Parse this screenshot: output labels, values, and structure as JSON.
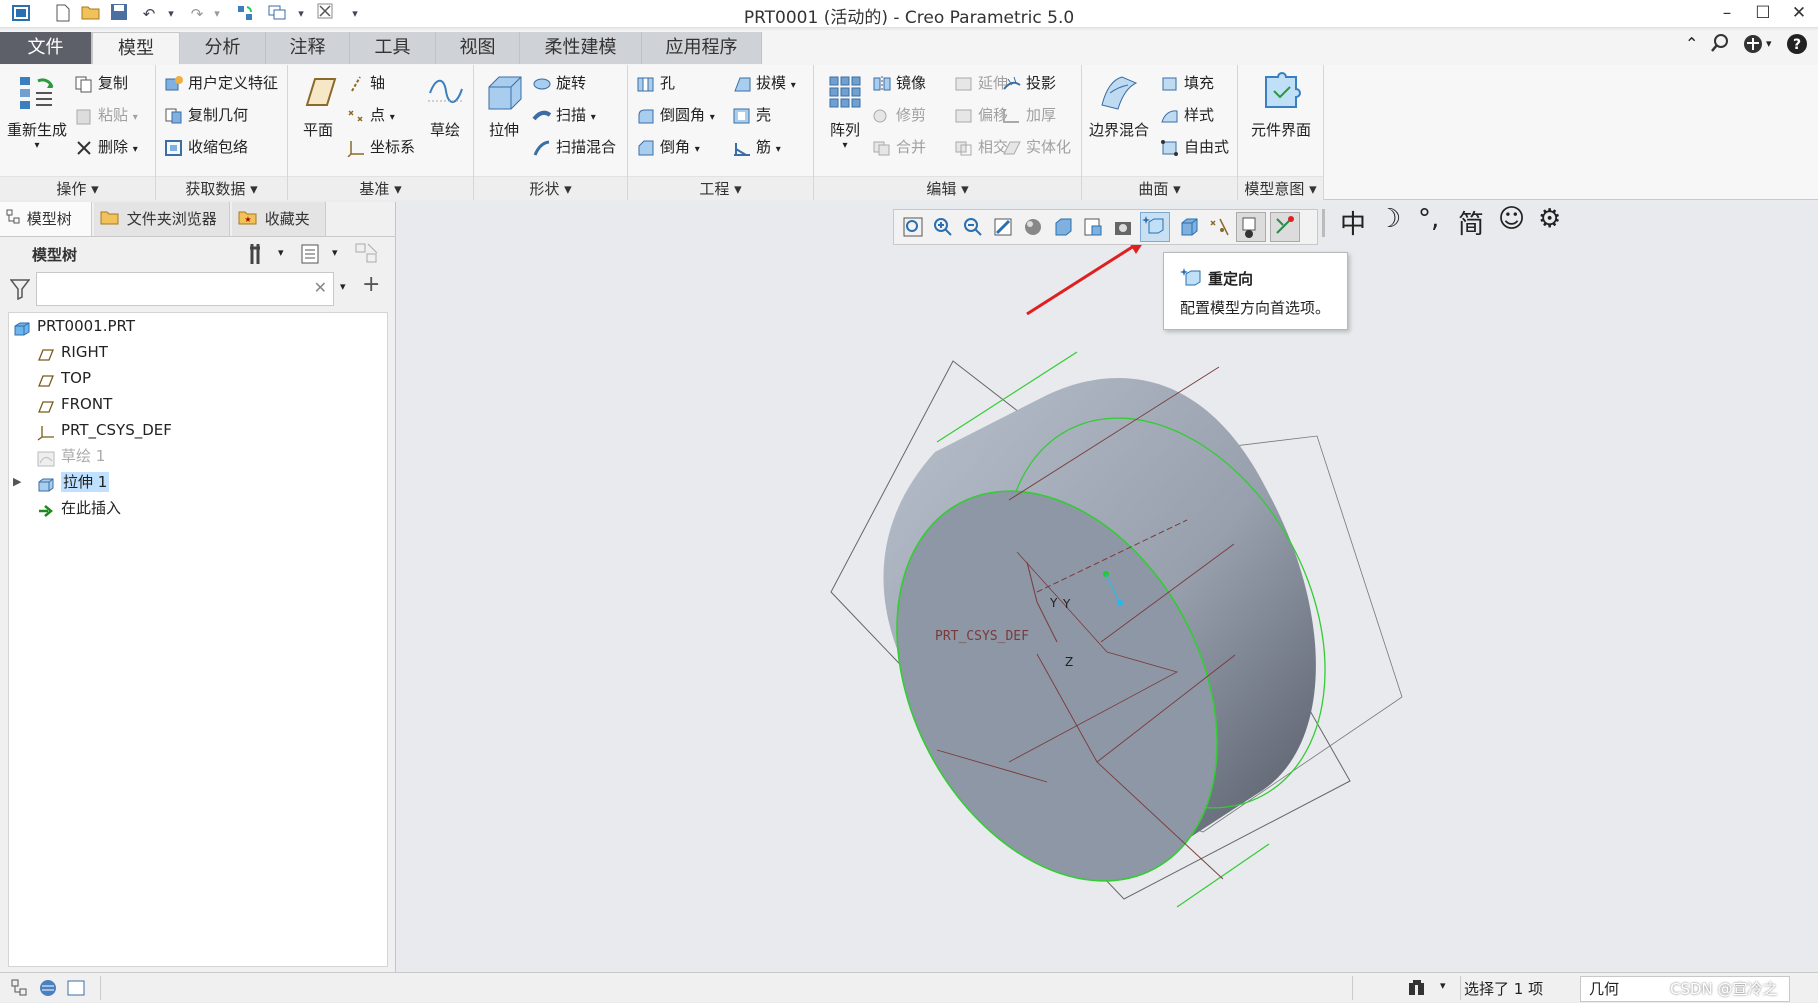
{
  "window": {
    "title": "PRT0001 (活动的) - Creo Parametric 5.0",
    "minimize": "–",
    "maximize": "☐",
    "close": "✕"
  },
  "tabs": [
    "文件",
    "模型",
    "分析",
    "注释",
    "工具",
    "视图",
    "柔性建模",
    "应用程序"
  ],
  "ribbon": {
    "operations": {
      "regenerate": "重新生成",
      "copy": "复制",
      "paste": "粘贴",
      "delete": "删除",
      "footer": "操作 ▾"
    },
    "getdata": {
      "udf": "用户定义特征",
      "copygeom": "复制几何",
      "shrinkwrap": "收缩包络",
      "footer": "获取数据 ▾"
    },
    "datum": {
      "plane": "平面",
      "axis": "轴",
      "point": "点",
      "csys": "坐标系",
      "sketch": "草绘",
      "footer": "基准 ▾"
    },
    "shapes": {
      "extrude": "拉伸",
      "revolve": "旋转",
      "sweep": "扫描",
      "sweptblend": "扫描混合",
      "footer": "形状 ▾"
    },
    "engineering": {
      "hole": "孔",
      "draft": "拔模",
      "round": "倒圆角",
      "shell": "壳",
      "chamfer": "倒角",
      "rib": "筋",
      "footer": "工程 ▾"
    },
    "editing": {
      "pattern": "阵列",
      "mirror": "镜像",
      "extend": "延伸",
      "project": "投影",
      "trim": "修剪",
      "offset": "偏移",
      "thicken": "加厚",
      "merge": "合并",
      "intersect": "相交",
      "solidify": "实体化",
      "footer": "编辑 ▾"
    },
    "surfaces": {
      "boundary": "边界混合",
      "fill": "填充",
      "style": "样式",
      "freestyle": "自由式",
      "footer": "曲面 ▾"
    },
    "intent": {
      "component": "元件界面",
      "footer": "模型意图 ▾"
    }
  },
  "leftpanel": {
    "tabs": [
      "模型树",
      "文件夹浏览器",
      "收藏夹"
    ],
    "header": "模型树",
    "search_placeholder": "",
    "tree": [
      {
        "label": "PRT0001.PRT",
        "icon": "part-icon",
        "dim": false
      },
      {
        "label": "RIGHT",
        "icon": "datum-plane-icon",
        "dim": false
      },
      {
        "label": "TOP",
        "icon": "datum-plane-icon",
        "dim": false
      },
      {
        "label": "FRONT",
        "icon": "datum-plane-icon",
        "dim": false
      },
      {
        "label": "PRT_CSYS_DEF",
        "icon": "csys-icon",
        "dim": false
      },
      {
        "label": "草绘 1",
        "icon": "sketch-icon",
        "dim": true
      },
      {
        "label": "拉伸 1",
        "icon": "extrude-icon",
        "dim": false,
        "selected": true
      },
      {
        "label": "在此插入",
        "icon": "insert-arrow-icon",
        "dim": false
      }
    ]
  },
  "viewport": {
    "symbols": [
      "中",
      "☽",
      "°,",
      "简",
      "☺",
      "⚙"
    ],
    "tooltip": {
      "title": "重定向",
      "description": "配置模型方向首选项。"
    },
    "csys_label": "PRT_CSYS_DEF",
    "axis_y": "Y",
    "axis_y2": "Y",
    "axis_z": "Z"
  },
  "statusbar": {
    "selection": "选择了 1 项",
    "filter": "几何",
    "watermark": "CSDN @宣冷之"
  },
  "colors": {
    "model_fill": "#8e97a6",
    "edge_green": "#33cc33",
    "arrow_red": "#e02020",
    "selected_bg": "#bfe0ff"
  }
}
